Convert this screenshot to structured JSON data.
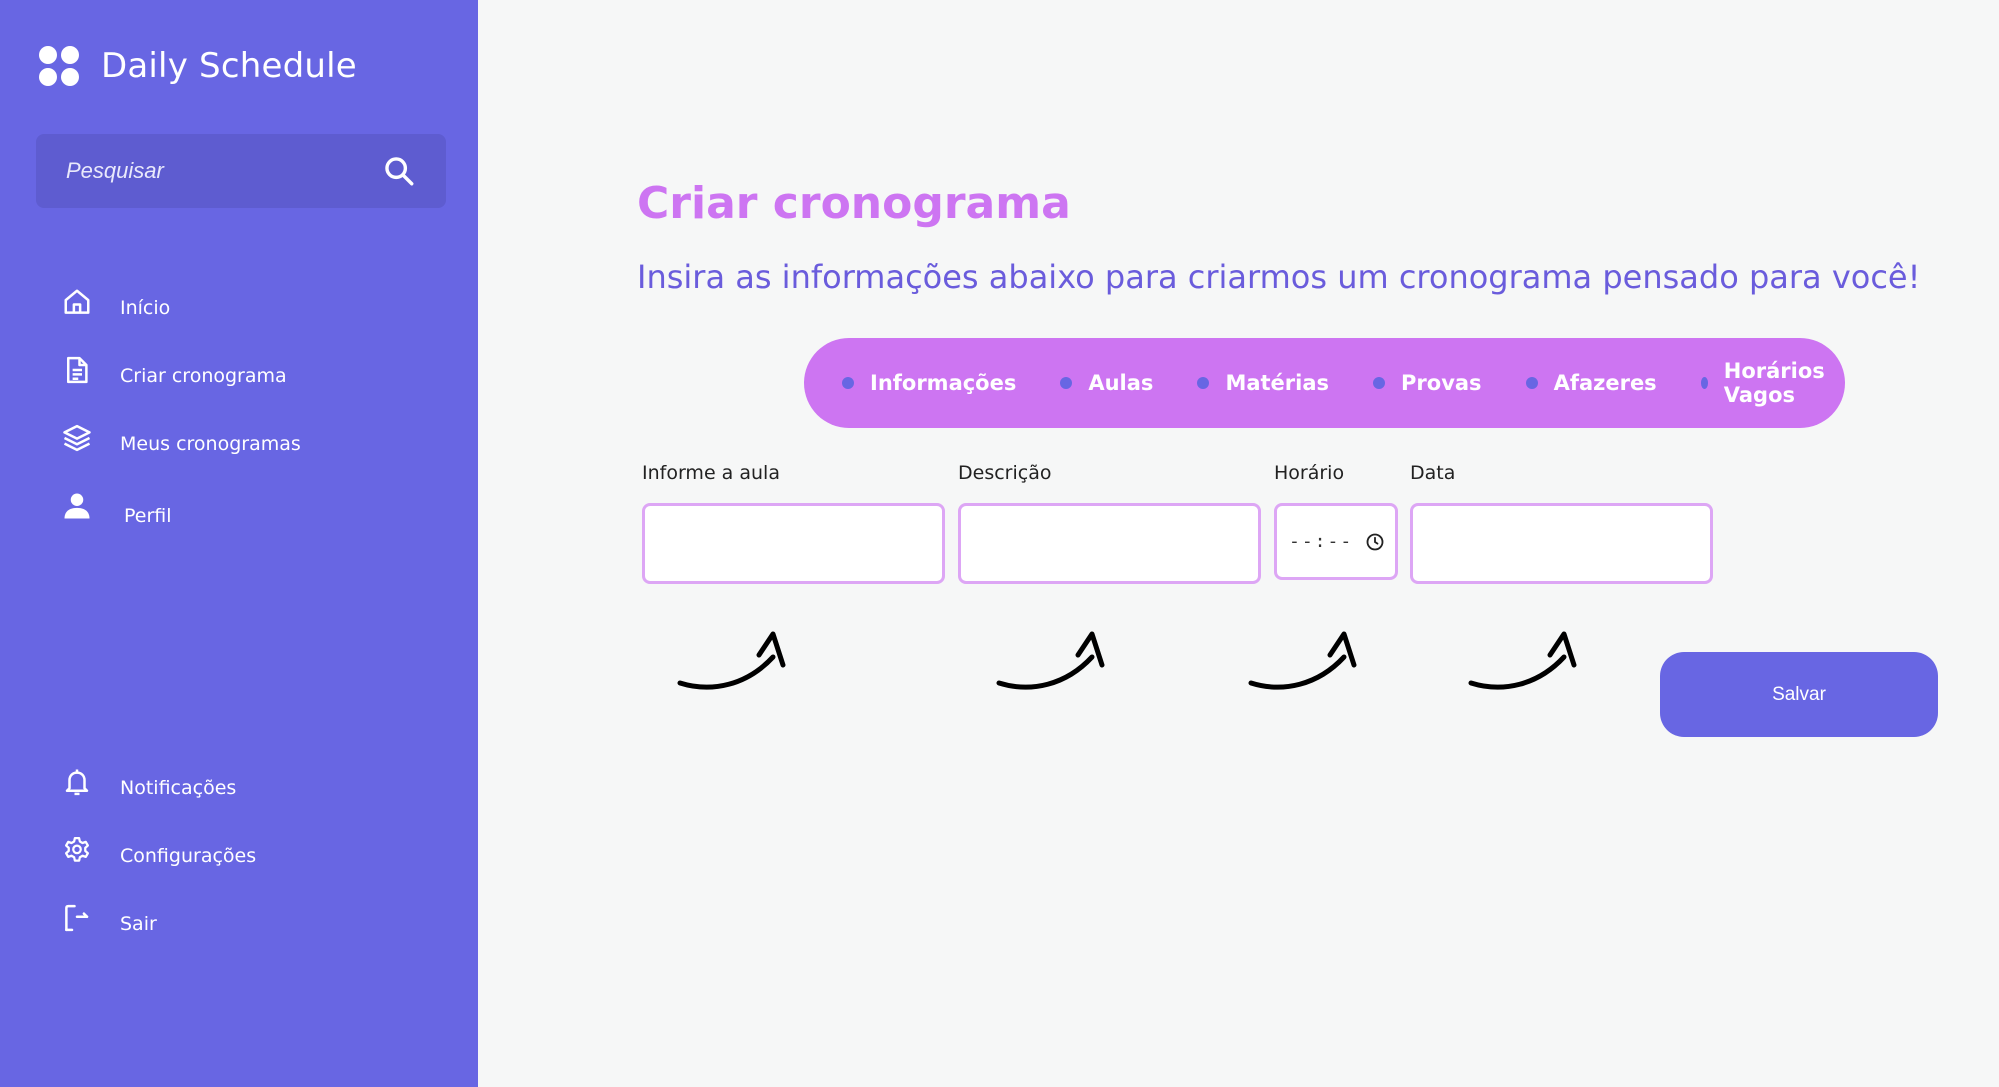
{
  "app": {
    "title": "Daily Schedule"
  },
  "search": {
    "placeholder": "Pesquisar"
  },
  "sidebar": {
    "nav_top": [
      {
        "label": "Início",
        "icon": "home-icon"
      },
      {
        "label": "Criar cronograma",
        "icon": "document-icon"
      },
      {
        "label": "Meus cronogramas",
        "icon": "layers-icon"
      },
      {
        "label": "Perfil",
        "icon": "user-icon"
      }
    ],
    "nav_bottom": [
      {
        "label": "Notificações",
        "icon": "bell-icon"
      },
      {
        "label": "Configurações",
        "icon": "gear-icon"
      },
      {
        "label": "Sair",
        "icon": "logout-icon"
      }
    ]
  },
  "main": {
    "title": "Criar cronograma",
    "subtitle": "Insira as informações abaixo para criarmos um cronograma pensado para você!",
    "steps": [
      "Informações",
      "Aulas",
      "Matérias",
      "Provas",
      "Afazeres",
      "Horários Vagos"
    ],
    "form": {
      "aula_label": "Informe a aula",
      "aula_value": "",
      "descricao_label": "Descrição",
      "descricao_value": "",
      "horario_label": "Horário",
      "horario_value": "--:--",
      "data_label": "Data",
      "data_value": ""
    },
    "save_label": "Salvar"
  },
  "colors": {
    "sidebar_bg": "#6866e3",
    "accent_pink": "#cd75f2",
    "subtitle_purple": "#6a5cdc",
    "page_bg": "#f6f7f7"
  }
}
